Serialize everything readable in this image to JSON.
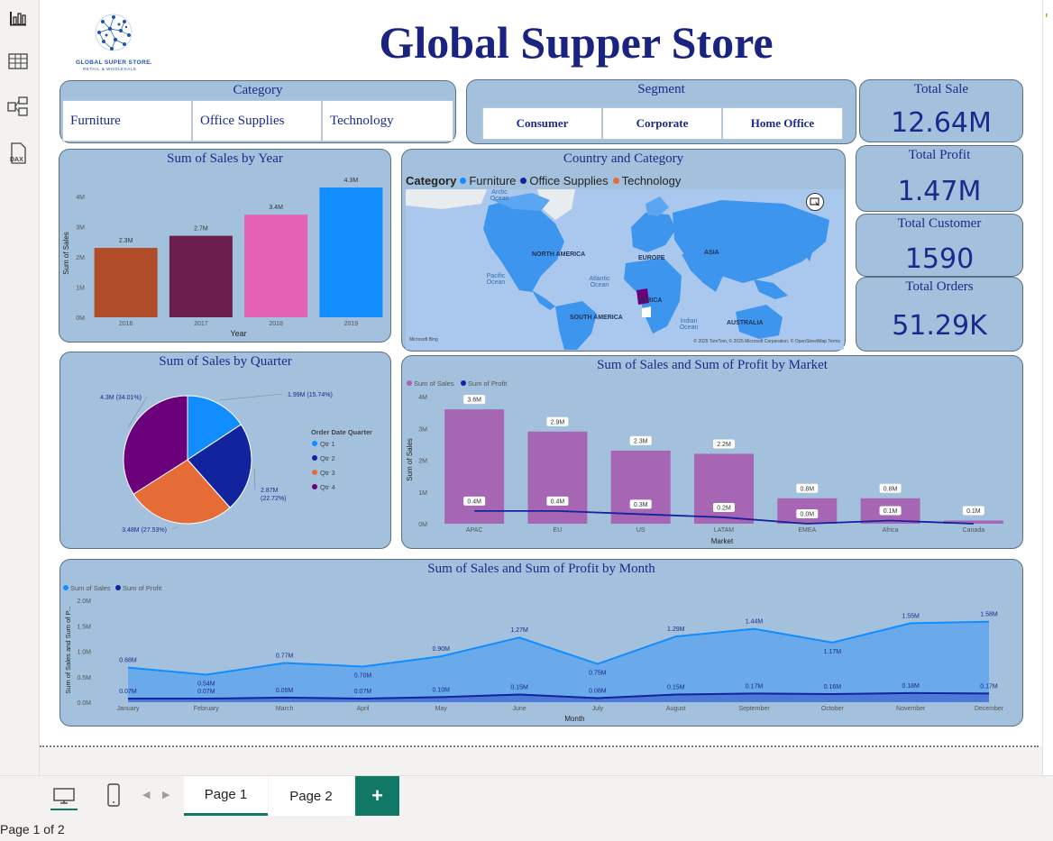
{
  "report": {
    "title": "Global Supper Store",
    "logo_text_1": "GLOBAL SUPER STORE.",
    "logo_text_2": "RETAIL & WHOLESALE"
  },
  "left_rail": {
    "items": [
      {
        "icon": "report-view-icon"
      },
      {
        "icon": "table-view-icon"
      },
      {
        "icon": "model-view-icon"
      },
      {
        "icon": "dax-query-icon",
        "label": "DAX"
      }
    ]
  },
  "category_slicer": {
    "title": "Category",
    "options": [
      "Furniture",
      "Office Supplies",
      "Technology"
    ]
  },
  "segment_slicer": {
    "title": "Segment",
    "options": [
      "Consumer",
      "Corporate",
      "Home Office"
    ]
  },
  "kpis": {
    "total_sale": {
      "label": "Total Sale",
      "value": "12.64M"
    },
    "total_profit": {
      "label": "Total Profit",
      "value": "1.47M"
    },
    "total_customer": {
      "label": "Total Customer",
      "value": "1590"
    },
    "total_orders": {
      "label": "Total Orders",
      "value": "51.29K"
    }
  },
  "map": {
    "title": "Country and Category",
    "legend_title": "Category",
    "legend": [
      {
        "name": "Furniture",
        "color": "#118dff"
      },
      {
        "name": "Office Supplies",
        "color": "#12239e"
      },
      {
        "name": "Technology",
        "color": "#e66c37"
      }
    ],
    "labels": {
      "arctic": "Arctic Ocean",
      "north_america": "NORTH AMERICA",
      "europe": "EUROPE",
      "asia": "ASIA",
      "pacific": "Pacific Ocean",
      "atlantic": "Atlantic Ocean",
      "africa": "AFRICA",
      "south_america": "SOUTH AMERICA",
      "indian": "Indian Ocean",
      "australia": "AUSTRALIA"
    },
    "brand": "Microsoft Bing",
    "copyright": "© 2025 TomTom, © 2025 Microsoft Corporation, © OpenStreetMap Terms"
  },
  "chart_data": [
    {
      "id": "sales-by-year",
      "type": "bar",
      "title": "Sum of Sales by Year",
      "xlabel": "Year",
      "ylabel": "Sum of Sales",
      "categories": [
        "2016",
        "2017",
        "2018",
        "2019"
      ],
      "values": [
        2.3,
        2.7,
        3.4,
        4.3
      ],
      "data_labels": [
        "2.3M",
        "2.7M",
        "3.4M",
        "4.3M"
      ],
      "colors": [
        "#b04c27",
        "#6a1f4f",
        "#e362b5",
        "#118dff"
      ],
      "ylim": [
        0,
        4.3
      ],
      "yticks": [
        0,
        1,
        2,
        3,
        4
      ],
      "ytick_labels": [
        "0M",
        "1M",
        "2M",
        "3M",
        "4M"
      ]
    },
    {
      "id": "sales-by-quarter",
      "type": "pie",
      "title": "Sum of Sales by Quarter",
      "legend_title": "Order Date Quarter",
      "slices": [
        {
          "name": "Qtr 1",
          "value": 1.99,
          "label": "1.99M (15.74%)",
          "color": "#118dff"
        },
        {
          "name": "Qtr 2",
          "value": 2.87,
          "label": "2.87M (22.72%)",
          "color": "#12239e"
        },
        {
          "name": "Qtr 3",
          "value": 3.48,
          "label": "3.48M (27.53%)",
          "color": "#e66c37"
        },
        {
          "name": "Qtr 4",
          "value": 4.3,
          "label": "4.3M (34.01%)",
          "color": "#6b007b"
        }
      ]
    },
    {
      "id": "sales-profit-by-market",
      "type": "bar",
      "title": "Sum of Sales and Sum of Profit by Market",
      "xlabel": "Market",
      "ylabel": "Sum of Sales",
      "categories": [
        "APAC",
        "EU",
        "US",
        "LATAM",
        "EMEA",
        "Africa",
        "Canada"
      ],
      "series": [
        {
          "name": "Sum of Sales",
          "values": [
            3.6,
            2.9,
            2.3,
            2.2,
            0.8,
            0.8,
            0.1
          ],
          "labels": [
            "3.6M",
            "2.9M",
            "2.3M",
            "2.2M",
            "0.8M",
            "0.8M",
            "0.1M"
          ],
          "color": "#a766b4"
        },
        {
          "name": "Sum of Profit",
          "values": [
            0.4,
            0.4,
            0.3,
            0.2,
            0.0,
            0.1,
            0.0
          ],
          "labels": [
            "0.4M",
            "0.4M",
            "0.3M",
            "0.2M",
            "0.0M",
            "0.1M",
            ""
          ],
          "color": "#12239e"
        }
      ],
      "ylim": [
        0,
        4
      ],
      "yticks": [
        0,
        1,
        2,
        3,
        4
      ],
      "ytick_labels": [
        "0M",
        "1M",
        "2M",
        "3M",
        "4M"
      ]
    },
    {
      "id": "sales-profit-by-month",
      "type": "area",
      "title": "Sum of Sales and Sum of Profit by Month",
      "xlabel": "Month",
      "ylabel": "Sum of Sales and Sum of P...",
      "categories": [
        "January",
        "February",
        "March",
        "April",
        "May",
        "June",
        "July",
        "August",
        "September",
        "October",
        "November",
        "December"
      ],
      "series": [
        {
          "name": "Sum of Sales",
          "values": [
            0.68,
            0.54,
            0.77,
            0.7,
            0.9,
            1.27,
            0.75,
            1.29,
            1.44,
            1.17,
            1.55,
            1.58
          ],
          "labels": [
            "0.68M",
            "0.54M",
            "0.77M",
            "0.70M",
            "0.90M",
            "1.27M",
            "0.75M",
            "1.29M",
            "1.44M",
            "1.17M",
            "1.55M",
            "1.58M"
          ],
          "color": "#118dff"
        },
        {
          "name": "Sum of Profit",
          "values": [
            0.07,
            0.07,
            0.09,
            0.07,
            0.1,
            0.15,
            0.08,
            0.15,
            0.17,
            0.16,
            0.18,
            0.17
          ],
          "labels": [
            "0.07M",
            "0.07M",
            "0.09M",
            "0.07M",
            "0.10M",
            "0.15M",
            "0.08M",
            "0.15M",
            "0.17M",
            "0.16M",
            "0.18M",
            "0.17M"
          ],
          "color": "#12239e"
        }
      ],
      "ylim": [
        0,
        2.0
      ],
      "yticks": [
        0,
        0.5,
        1.0,
        1.5,
        2.0
      ],
      "ytick_labels": [
        "0.0M",
        "0.5M",
        "1.0M",
        "1.5M",
        "2.0M"
      ]
    }
  ],
  "pages": {
    "tabs": [
      "Page 1",
      "Page 2"
    ],
    "active": "Page 1",
    "add_label": "+"
  },
  "status": {
    "text": "Page 1 of 2"
  }
}
